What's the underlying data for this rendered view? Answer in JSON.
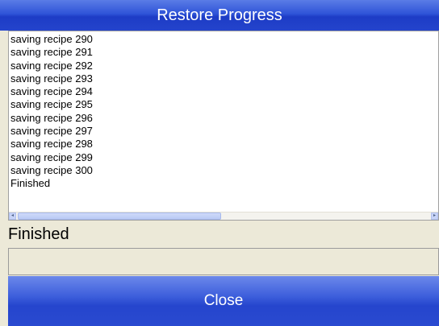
{
  "window": {
    "title": "Restore Progress"
  },
  "log": {
    "lines": [
      "saving recipe 290",
      "saving recipe 291",
      "saving recipe 292",
      "saving recipe 293",
      "saving recipe 294",
      "saving recipe 295",
      "saving recipe 296",
      "saving recipe 297",
      "saving recipe 298",
      "saving recipe 299",
      "saving recipe 300",
      "Finished"
    ],
    "scroll_left_glyph": "◂",
    "scroll_right_glyph": "▸"
  },
  "status": {
    "label": "Finished",
    "field_value": ""
  },
  "actions": {
    "close_label": "Close"
  },
  "colors": {
    "accent": "#2444cc",
    "background": "#ece9d8",
    "text_on_accent": "#ffffff"
  }
}
